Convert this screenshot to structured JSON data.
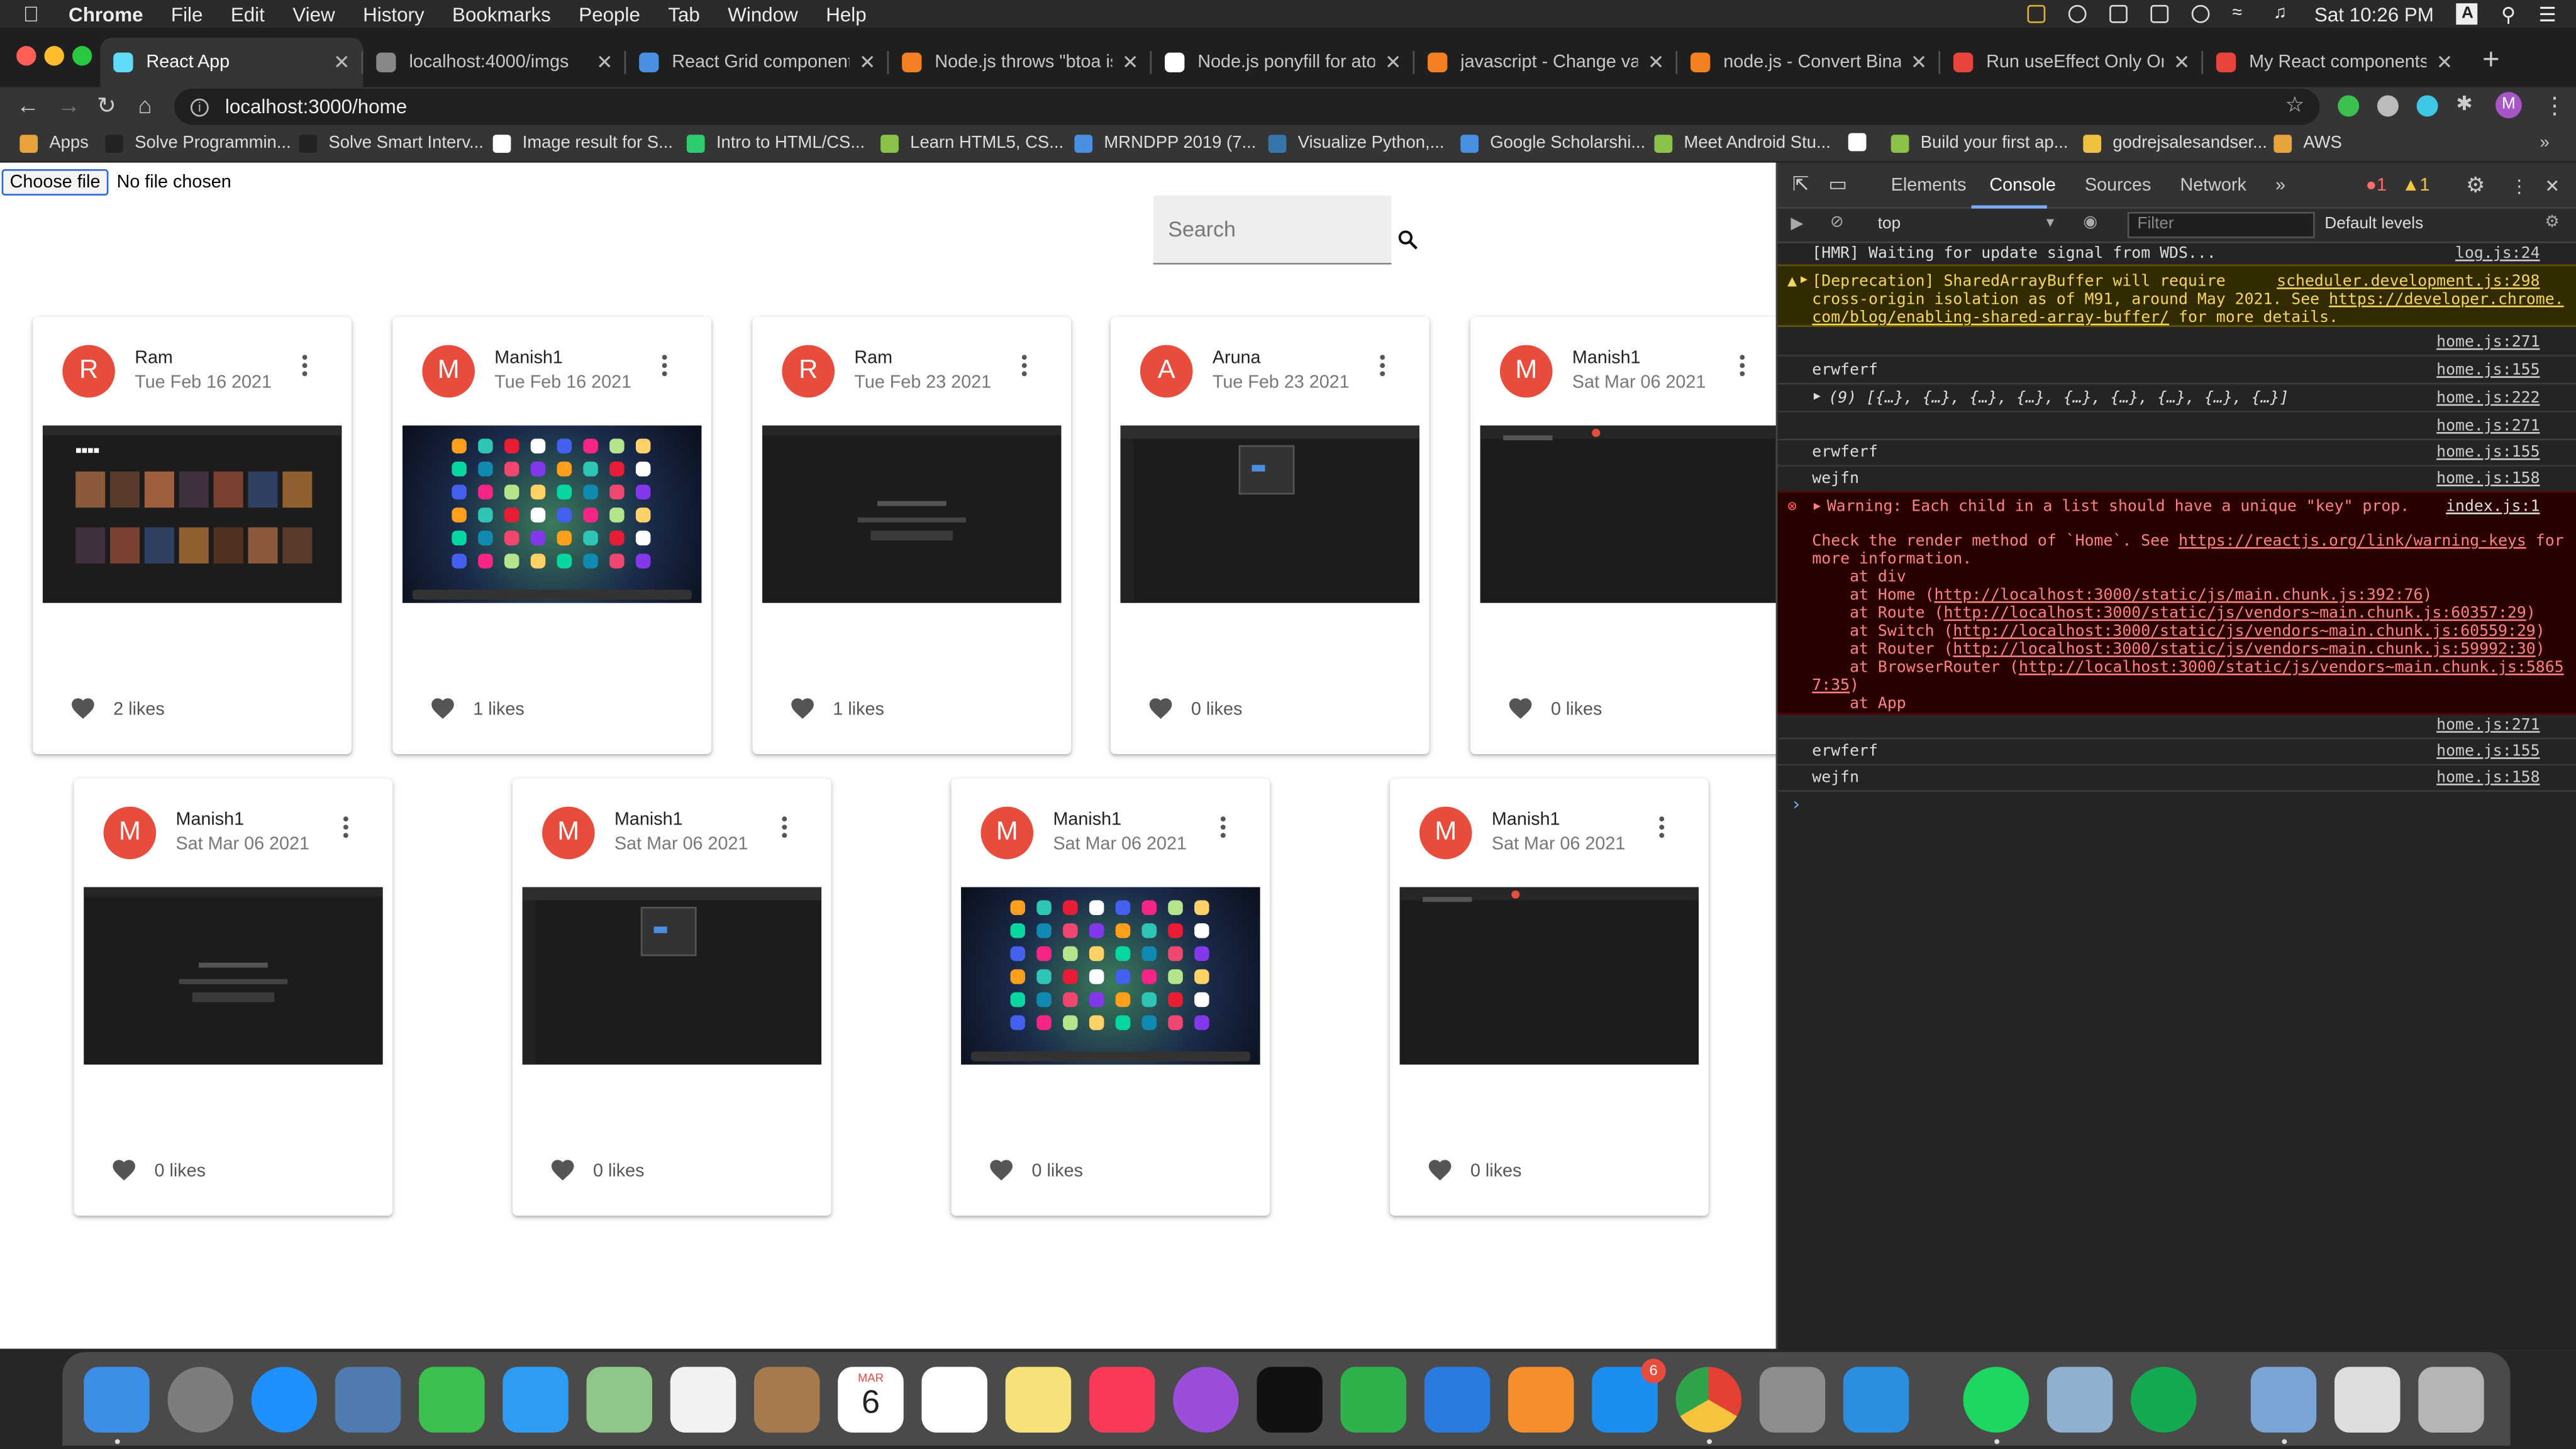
{
  "menubar": {
    "app": "Chrome",
    "items": [
      "File",
      "Edit",
      "View",
      "History",
      "Bookmarks",
      "People",
      "Tab",
      "Window",
      "Help"
    ],
    "clock": "Sat 10:26 PM",
    "user_letter": "A"
  },
  "tabs": [
    {
      "title": "React App",
      "color": "#61dafb"
    },
    {
      "title": "localhost:4000/imgs",
      "color": "#888888"
    },
    {
      "title": "React Grid component - I",
      "color": "#4a90e2"
    },
    {
      "title": "Node.js throws \"btoa is n",
      "color": "#f48024"
    },
    {
      "title": "Node.js ponyfill for atob a",
      "color": "#ffffff"
    },
    {
      "title": "javascript - Change value",
      "color": "#f48024"
    },
    {
      "title": "node.js - Convert Binary",
      "color": "#f48024"
    },
    {
      "title": "Run useEffect Only Once",
      "color": "#e8453c"
    },
    {
      "title": "My React components re",
      "color": "#e8453c"
    }
  ],
  "toolbar": {
    "url": "localhost:3000/home",
    "profile_letter": "M"
  },
  "bookmarks": [
    {
      "label": "Apps",
      "color": "#e8a33c"
    },
    {
      "label": "Solve Programmin...",
      "color": "#222222"
    },
    {
      "label": "Solve Smart Interv...",
      "color": "#222222"
    },
    {
      "label": "Image result for S...",
      "color": "#ffffff"
    },
    {
      "label": "Intro to HTML/CS...",
      "color": "#2ecc71"
    },
    {
      "label": "Learn HTML5, CS...",
      "color": "#8bc34a"
    },
    {
      "label": "MRNDPP 2019 (7...",
      "color": "#4a90e2"
    },
    {
      "label": "Visualize Python,...",
      "color": "#3776ab"
    },
    {
      "label": "Google Scholarshi...",
      "color": "#4a90e2"
    },
    {
      "label": "Meet Android Stu...",
      "color": "#8bc34a"
    },
    {
      "label": "",
      "color": "#ffffff"
    },
    {
      "label": "Build your first ap...",
      "color": "#8bc34a"
    },
    {
      "label": "godrejsalesandser...",
      "color": "#f0c040"
    },
    {
      "label": "AWS",
      "color": "#e8a33c"
    }
  ],
  "page": {
    "choose_file": "Choose file",
    "no_file": "No file chosen",
    "search_placeholder": "Search"
  },
  "posts": [
    {
      "initial": "R",
      "name": "Ram",
      "date": "Tue Feb 16 2021",
      "likes": "2 likes",
      "thumb": "netflix"
    },
    {
      "initial": "M",
      "name": "Manish1",
      "date": "Tue Feb 16 2021",
      "likes": "1 likes",
      "thumb": "launchpad"
    },
    {
      "initial": "R",
      "name": "Ram",
      "date": "Tue Feb 23 2021",
      "likes": "1 likes",
      "thumb": "dark"
    },
    {
      "initial": "A",
      "name": "Aruna",
      "date": "Tue Feb 23 2021",
      "likes": "0 likes",
      "thumb": "menu"
    },
    {
      "initial": "M",
      "name": "Manish1",
      "date": "Sat Mar 06 2021",
      "likes": "0 likes",
      "thumb": "dark2"
    },
    {
      "initial": "M",
      "name": "Manish1",
      "date": "Sat Mar 06 2021",
      "likes": "0 likes",
      "thumb": "dark"
    },
    {
      "initial": "M",
      "name": "Manish1",
      "date": "Sat Mar 06 2021",
      "likes": "0 likes",
      "thumb": "menu"
    },
    {
      "initial": "M",
      "name": "Manish1",
      "date": "Sat Mar 06 2021",
      "likes": "0 likes",
      "thumb": "launchpad"
    },
    {
      "initial": "M",
      "name": "Manish1",
      "date": "Sat Mar 06 2021",
      "likes": "0 likes",
      "thumb": "dark2"
    }
  ],
  "devtools": {
    "tabs": [
      "Elements",
      "Console",
      "Sources",
      "Network"
    ],
    "error_count": "1",
    "warn_count": "1",
    "context": "top",
    "filter_placeholder": "Filter",
    "levels": "Default levels",
    "logs": {
      "hmr": "[HMR] Waiting for update signal from WDS...",
      "hmr_src": "log.js:24",
      "warn1": "[Deprecation] SharedArrayBuffer will require",
      "warn_src": "scheduler.development.js:298",
      "warn2": "cross-origin isolation as of M91, around May 2021. See ",
      "warn2_link": "https://developer.chrome.",
      "warn3_link": "com/blog/enabling-shared-array-buffer/",
      "warn3": " for more details.",
      "home271": "home.js:271",
      "home155": "home.js:155",
      "home222": "home.js:222",
      "home158": "home.js:158",
      "index1": "index.js:1",
      "erwferf": "erwferf",
      "array": "(9) [{…}, {…}, {…}, {…}, {…}, {…}, {…}, {…}, {…}]",
      "wejfn": "wejfn",
      "err1": "Warning: Each child in a list should have a unique \"key\" prop.",
      "err2": "Check the render method of `Home`. See ",
      "err2_link": "https://reactjs.org/link/warning-keys",
      "err2b": " for",
      "err3": "more information.",
      "err4": "    at div",
      "err5": "    at Home (",
      "err5_link": "http://localhost:3000/static/js/main.chunk.js:392:76",
      "err6": "    at Route (",
      "err6_link": "http://localhost:3000/static/js/vendors~main.chunk.js:60357:29",
      "err7": "    at Switch (",
      "err7_link": "http://localhost:3000/static/js/vendors~main.chunk.js:60559:29",
      "err8": "    at Router (",
      "err8_link": "http://localhost:3000/static/js/vendors~main.chunk.js:59992:30",
      "err9": "    at BrowserRouter (",
      "err9_link": "http://localhost:3000/static/js/vendors~main.chunk.js:5865",
      "err10": "7:35",
      "err11": "    at App"
    }
  },
  "dock": {
    "calendar_month": "MAR",
    "calendar_day": "6",
    "appstore_badge": "6",
    "apps": [
      {
        "name": "finder",
        "color": "#3d8ee6"
      },
      {
        "name": "launchpad",
        "color": "#7d7d7d"
      },
      {
        "name": "safari",
        "color": "#1e90ff"
      },
      {
        "name": "mail-eagle",
        "color": "#4f7bb0"
      },
      {
        "name": "facetime",
        "color": "#3cc14e"
      },
      {
        "name": "messages",
        "color": "#2f9cf4"
      },
      {
        "name": "maps",
        "color": "#8fc78a"
      },
      {
        "name": "photos",
        "color": "#f2f2f2"
      },
      {
        "name": "contacts",
        "color": "#a57a4f"
      },
      {
        "name": "calendar",
        "color": "#ffffff"
      },
      {
        "name": "reminders",
        "color": "#ffffff"
      },
      {
        "name": "notes",
        "color": "#f7e27a"
      },
      {
        "name": "music",
        "color": "#fb3a5a"
      },
      {
        "name": "podcasts",
        "color": "#9b4ddc"
      },
      {
        "name": "tv",
        "color": "#111111"
      },
      {
        "name": "numbers",
        "color": "#2fb24c"
      },
      {
        "name": "keynote",
        "color": "#2a7bdf"
      },
      {
        "name": "pages",
        "color": "#f58f2e"
      },
      {
        "name": "app-store",
        "color": "#1c8ef2"
      },
      {
        "name": "chrome",
        "color": "#e34133"
      },
      {
        "name": "system-preferences",
        "color": "#8e8e8e"
      },
      {
        "name": "vscode",
        "color": "#2a8fe0"
      },
      {
        "name": "spotify",
        "color": "#1ed760"
      },
      {
        "name": "preview",
        "color": "#8fb0d0"
      },
      {
        "name": "mongodb-compass",
        "color": "#13aa52"
      },
      {
        "name": "downloads-folder",
        "color": "#7aa3d6"
      },
      {
        "name": "recent-screenshot",
        "color": "#dddddd"
      },
      {
        "name": "trash",
        "color": "#b5b5b5"
      }
    ]
  }
}
